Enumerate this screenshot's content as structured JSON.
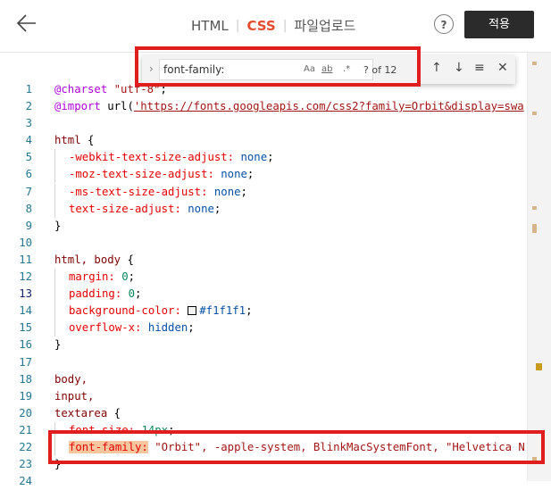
{
  "header": {
    "back_icon": "arrow-left-icon",
    "tabs": [
      {
        "label": "HTML",
        "active": false
      },
      {
        "label": "CSS",
        "active": true
      },
      {
        "label": "파일업로드",
        "active": false
      }
    ],
    "help_label": "?",
    "apply_label": "적용"
  },
  "find": {
    "query": "font-family:",
    "match_case": "Aa",
    "whole_word": "ab",
    "regex": ".*",
    "count": "? of 12"
  },
  "editor": {
    "line_numbers": [
      "1",
      "2",
      "3",
      "4",
      "5",
      "6",
      "7",
      "8",
      "9",
      "10",
      "11",
      "12",
      "13",
      "14",
      "15",
      "16",
      "17",
      "18",
      "19",
      "20",
      "21",
      "22",
      "23",
      "24"
    ]
  },
  "code": {
    "l1_at": "@charset",
    "l1_str": "\"utf-8\"",
    "l1_end": ";",
    "l2_at": "@import",
    "l2_fn": "url(",
    "l2_url": "'https://fonts.googleapis.com/css2?family=Orbit&display=swa",
    "l4_sel": "html",
    "l4_brace": " {",
    "l5_prop": "-webkit-text-size-adjust:",
    "l5_val": "none",
    "l6_prop": "-moz-text-size-adjust:",
    "l6_val": "none",
    "l7_prop": "-ms-text-size-adjust:",
    "l7_val": "none",
    "l8_prop": "text-size-adjust:",
    "l8_val": "none",
    "l9": "}",
    "l11_sel": "html, body",
    "l11_brace": " {",
    "l12_prop": "margin:",
    "l12_val": "0",
    "l13_prop": "padding:",
    "l13_val": "0",
    "l14_prop": "background-color:",
    "l14_val": "#f1f1f1",
    "l15_prop": "overflow-x:",
    "l15_val": "hidden",
    "l16": "}",
    "l18_sel": "body,",
    "l19_sel": "input,",
    "l20_sel": "textarea",
    "l20_brace": " {",
    "l21_prop": "font-size:",
    "l21_val": "14px",
    "l22_prop": "font-family:",
    "l22_val": "\"Orbit\", -apple-system, BlinkMacSystemFont, \"Helvetica N",
    "l23": "}"
  }
}
